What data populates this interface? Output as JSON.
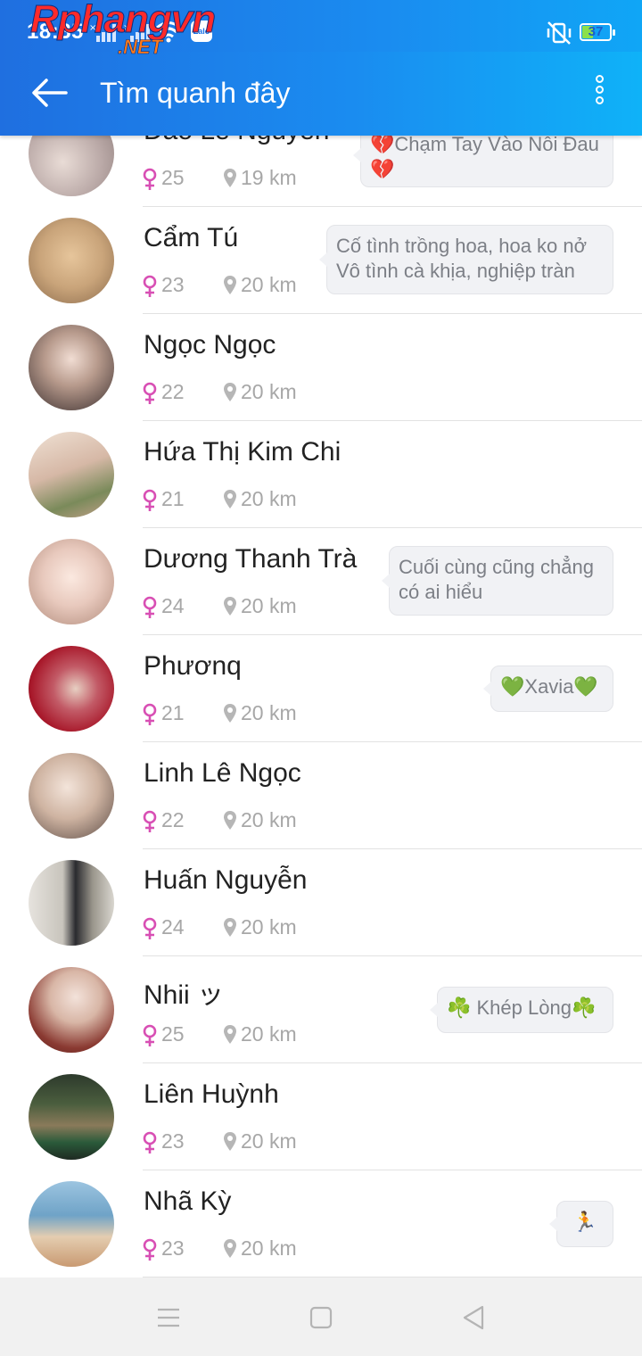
{
  "status_bar": {
    "time": "18:35",
    "battery": "37",
    "app_icon": "Zalo"
  },
  "app_bar": {
    "title": "Tìm quanh đây",
    "back_icon": "back-arrow-icon",
    "menu_icon": "more-vertical-icon"
  },
  "watermark": {
    "main": "Rphangvn",
    "sub": ".NET"
  },
  "distance_unit": "km",
  "users": [
    {
      "name": "Đào Lê Nguyễn",
      "age": "25",
      "distance": "19 km",
      "status": "💔Chạm Tay Vào Nỗi Đau💔",
      "avatar_color": "#b9a8a6"
    },
    {
      "name": "Cẩm Tú",
      "age": "23",
      "distance": "20 km",
      "status": "Cố tình trồng hoa, hoa ko nở Vô tình cà khịa, nghiệp tràn",
      "avatar_color": "#c9a47a"
    },
    {
      "name": "Ngọc Ngọc",
      "age": "22",
      "distance": "20 km",
      "status": "",
      "avatar_color": "#7a6a62"
    },
    {
      "name": "Hứa Thị Kim Chi",
      "age": "21",
      "distance": "20 km",
      "status": "",
      "avatar_color": "#d6b8a6"
    },
    {
      "name": "Dương Thanh Trà",
      "age": "24",
      "distance": "20 km",
      "status": "Cuối cùng cũng chẳng có ai hiểu",
      "avatar_color": "#e8c9bd"
    },
    {
      "name": "Phươnq",
      "age": "21",
      "distance": "20 km",
      "status": "💚Xavia💚",
      "avatar_color": "#a8182a"
    },
    {
      "name": "Linh Lê Ngọc",
      "age": "22",
      "distance": "20 km",
      "status": "",
      "avatar_color": "#cfb4a2"
    },
    {
      "name": "Huấn Nguyễn",
      "age": "24",
      "distance": "20 km",
      "status": "",
      "avatar_color": "#9a968c"
    },
    {
      "name": "Nhii ッ",
      "age": "25",
      "distance": "20 km",
      "status": "☘️ Khép Lòng☘️",
      "avatar_color": "#8a3a32"
    },
    {
      "name": "Liên Huỳnh",
      "age": "23",
      "distance": "20 km",
      "status": "",
      "avatar_color": "#3c4a3a"
    },
    {
      "name": "Nhã Kỳ",
      "age": "23",
      "distance": "20 km",
      "status": "🏃",
      "avatar_color": "#6fa3c7"
    }
  ],
  "nav_bar": {
    "recents_icon": "menu-icon",
    "home_icon": "square-icon",
    "back_icon": "triangle-back-icon"
  }
}
